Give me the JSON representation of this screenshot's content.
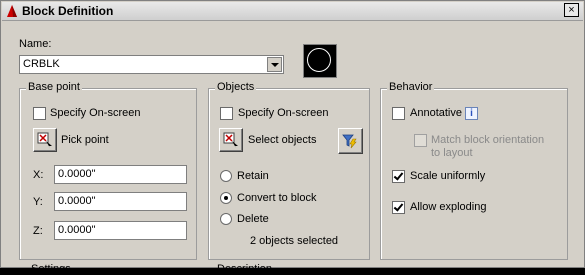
{
  "title": "Block Definition",
  "close_label": "×",
  "name": {
    "label": "Name:",
    "value": "CRBLK"
  },
  "base_point": {
    "title": "Base point",
    "specify_onscreen": "Specify On-screen",
    "pick_point": "Pick point",
    "x_label": "X:",
    "x_value": "0.0000\"",
    "y_label": "Y:",
    "y_value": "0.0000\"",
    "z_label": "Z:",
    "z_value": "0.0000\""
  },
  "objects": {
    "title": "Objects",
    "specify_onscreen": "Specify On-screen",
    "select_objects": "Select objects",
    "retain": "Retain",
    "convert_to_block": "Convert to block",
    "delete": "Delete",
    "selected_count": "2 objects selected"
  },
  "behavior": {
    "title": "Behavior",
    "annotative": "Annotative",
    "info": "i",
    "match_orientation_line1": "Match block orientation",
    "match_orientation_line2": "to layout",
    "scale_uniformly": "Scale uniformly",
    "allow_exploding": "Allow exploding"
  },
  "bottom": {
    "settings": "Settings",
    "description": "Description"
  },
  "colors": {
    "dialog_bg": "#d4d0c8",
    "preview_bg": "#000000",
    "accent": "#cc0000"
  },
  "icons": [
    "autocad-logo-icon",
    "close-icon",
    "pick-point-icon",
    "select-objects-icon",
    "quick-select-filter-icon",
    "info-icon",
    "dropdown-arrow-icon"
  ]
}
